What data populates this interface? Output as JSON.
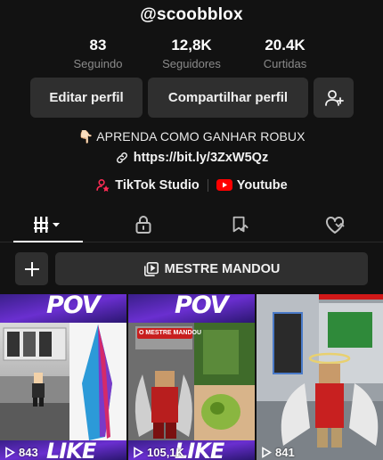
{
  "profile": {
    "username": "@scoobblox",
    "stats": [
      {
        "value": "83",
        "label": "Seguindo"
      },
      {
        "value": "12,8K",
        "label": "Seguidores"
      },
      {
        "value": "20.4K",
        "label": "Curtidas"
      }
    ],
    "edit_label": "Editar perfil",
    "share_label": "Compartilhar perfil",
    "bio": "👇🏻 APRENDA COMO GANHAR ROBUX",
    "link": "https://bit.ly/3ZxW5Qz",
    "shortcuts": {
      "studio_label": "TikTok Studio",
      "youtube_label": "Youtube"
    }
  },
  "tabs": [
    "videos-grid",
    "private",
    "reposts",
    "liked"
  ],
  "playlist": {
    "name": "MESTRE MANDOU"
  },
  "videos": [
    {
      "overlay_top": "POV",
      "overlay_bottom": "LIKE",
      "views": "843"
    },
    {
      "overlay_top": "POV",
      "overlay_bottom": "LIKE",
      "badge": "O MESTRE MANDOU",
      "views": "105,1K"
    },
    {
      "views": "841"
    }
  ],
  "colors": {
    "background": "#121212",
    "button": "#2f2f2f",
    "muted_text": "#8a8a8a",
    "studio_accent": "#fe2c55",
    "youtube_red": "#ff0000"
  }
}
